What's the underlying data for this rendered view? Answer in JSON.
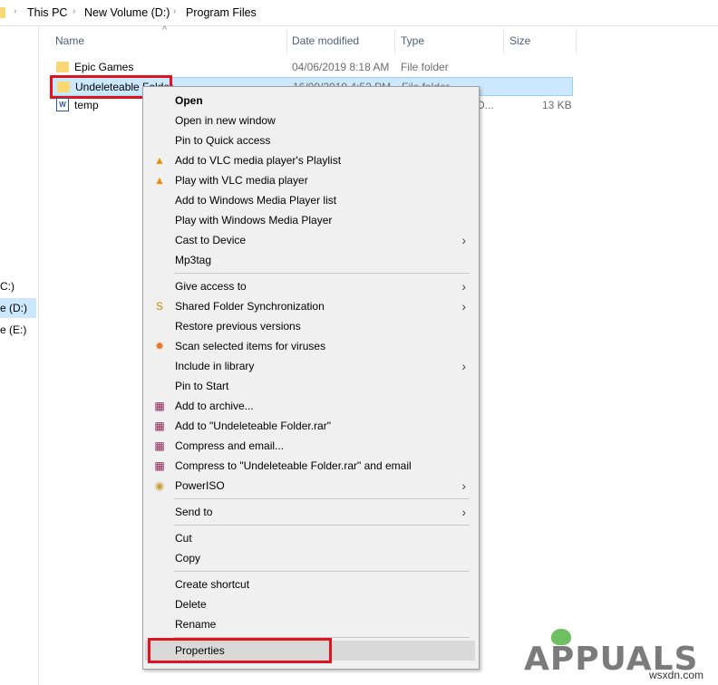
{
  "breadcrumb": [
    "This PC",
    "New Volume (D:)",
    "Program Files"
  ],
  "sidebar": {
    "drives": [
      "C:)",
      "e (D:)",
      "e (E:)"
    ]
  },
  "columns": {
    "name": "Name",
    "date": "Date modified",
    "type": "Type",
    "size": "Size"
  },
  "files": [
    {
      "name": "Epic Games",
      "date": "04/06/2019 8:18 AM",
      "type": "File folder",
      "size": "",
      "icon": "folder-icon"
    },
    {
      "name": "Undeleteable Folder",
      "date": "16/09/2019 4:52 PM",
      "type": "File folder",
      "size": "",
      "icon": "folder-icon",
      "selected": true
    },
    {
      "name": "temp",
      "date": "",
      "type": "D...",
      "size": "13 KB",
      "icon": "word-document-icon"
    }
  ],
  "context_menu": {
    "groups": [
      [
        {
          "label": "Open",
          "bold": true
        },
        {
          "label": "Open in new window"
        },
        {
          "label": "Pin to Quick access"
        },
        {
          "label": "Add to VLC media player's Playlist",
          "icon": "vlc-icon"
        },
        {
          "label": "Play with VLC media player",
          "icon": "vlc-icon"
        },
        {
          "label": "Add to Windows Media Player list"
        },
        {
          "label": "Play with Windows Media Player"
        },
        {
          "label": "Cast to Device",
          "submenu": true
        },
        {
          "label": "Mp3tag"
        }
      ],
      [
        {
          "label": "Give access to",
          "submenu": true
        },
        {
          "label": "Shared Folder Synchronization",
          "icon": "sync-icon",
          "submenu": true
        },
        {
          "label": "Restore previous versions"
        },
        {
          "label": "Scan selected items for viruses",
          "icon": "avast-icon"
        },
        {
          "label": "Include in library",
          "submenu": true
        },
        {
          "label": "Pin to Start"
        },
        {
          "label": "Add to archive...",
          "icon": "winrar-icon"
        },
        {
          "label": "Add to \"Undeleteable Folder.rar\"",
          "icon": "winrar-icon"
        },
        {
          "label": "Compress and email...",
          "icon": "winrar-icon"
        },
        {
          "label": "Compress to \"Undeleteable Folder.rar\" and email",
          "icon": "winrar-icon"
        },
        {
          "label": "PowerISO",
          "icon": "poweriso-icon",
          "submenu": true
        }
      ],
      [
        {
          "label": "Send to",
          "submenu": true
        }
      ],
      [
        {
          "label": "Cut"
        },
        {
          "label": "Copy"
        }
      ],
      [
        {
          "label": "Create shortcut"
        },
        {
          "label": "Delete"
        },
        {
          "label": "Rename"
        }
      ],
      [
        {
          "label": "Properties",
          "highlighted": true
        }
      ]
    ]
  },
  "watermark": {
    "logo": "APPUALS",
    "site": "wsxdn.com"
  },
  "colors": {
    "selection": "#cce8ff",
    "highlight_box": "#e0141e",
    "menu_bg": "#f0f0f0"
  }
}
